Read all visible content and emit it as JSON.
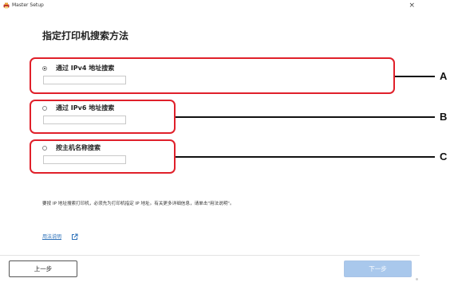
{
  "window": {
    "title": "Master Setup",
    "close_glyph": "×"
  },
  "heading": "指定打印机搜索方法",
  "options": [
    {
      "label": "通过 IPv4 地址搜索",
      "selected": true,
      "value": ""
    },
    {
      "label": "通过 IPv6 地址搜索",
      "selected": false,
      "value": ""
    },
    {
      "label": "按主机名称搜索",
      "selected": false,
      "value": ""
    }
  ],
  "callouts": [
    "A",
    "B",
    "C"
  ],
  "note": "要按 IP 地址搜索打印机，必须先为打印机指定 IP 地址。有关更多详细信息，请单击\"用法说明\"。",
  "help_link": "用法说明",
  "buttons": {
    "back": "上一步",
    "next": "下一步"
  },
  "colors": {
    "callout_border": "#e0202a",
    "link": "#2a6fb8",
    "next_button_disabled": "#a9c8ec"
  },
  "icons": {
    "app": "printer-setup-icon",
    "close": "close-icon",
    "external_link": "external-link-icon"
  }
}
